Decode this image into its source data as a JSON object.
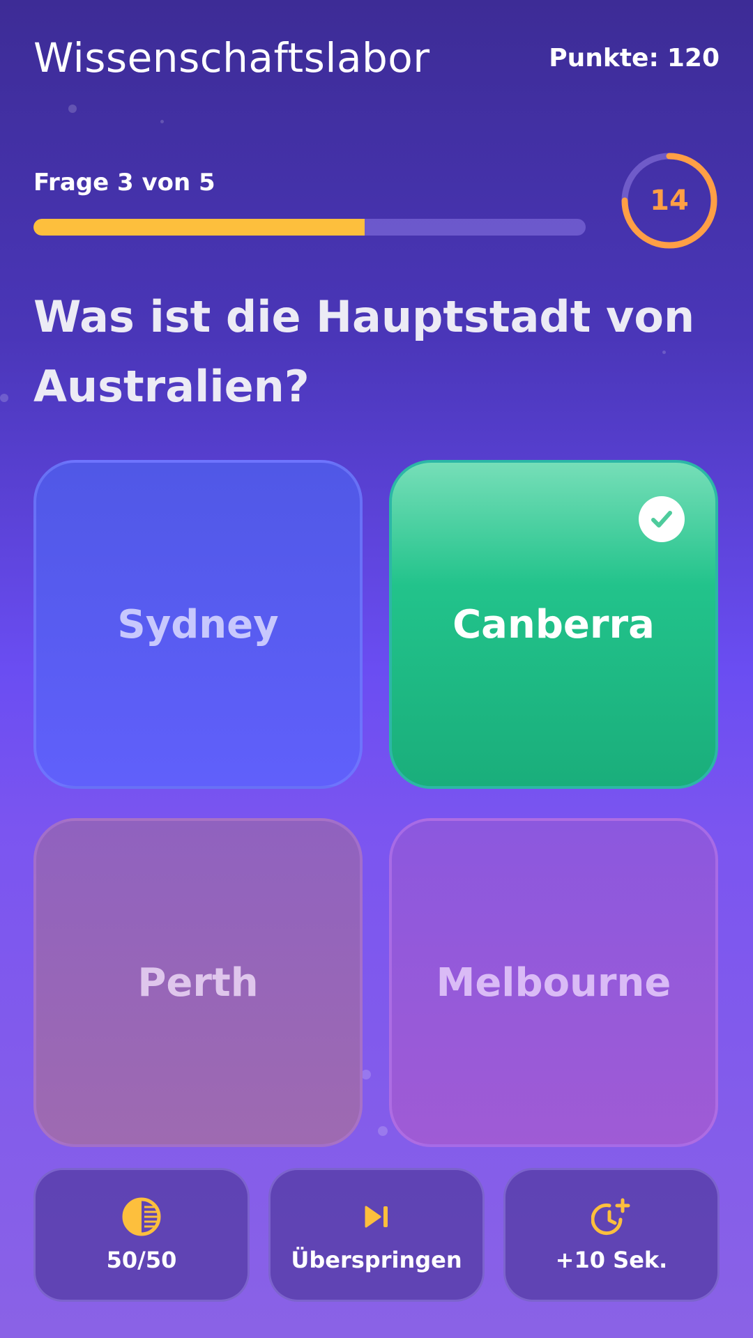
{
  "header": {
    "title": "Wissenschaftslabor",
    "score_label": "Punkte:",
    "score_value": "120"
  },
  "progress": {
    "counter_text": "Frage 3 von 5",
    "fraction_complete": 0.6
  },
  "timer": {
    "seconds_left": "14",
    "fraction_remaining": 0.75
  },
  "question": {
    "text": "Was ist die Hauptstadt von Australien?"
  },
  "answers": [
    {
      "label": "Sydney",
      "state": "default"
    },
    {
      "label": "Canberra",
      "state": "correct"
    },
    {
      "label": "Perth",
      "state": "default"
    },
    {
      "label": "Melbourne",
      "state": "default"
    }
  ],
  "lifelines": [
    {
      "label": "50/50",
      "icon": "half-circle-icon"
    },
    {
      "label": "Überspringen",
      "icon": "skip-next-icon"
    },
    {
      "label": "+10 Sek.",
      "icon": "clock-plus-icon"
    }
  ],
  "colors": {
    "accent_yellow": "#fdbf3d",
    "timer_orange": "#ff9f45",
    "correct_green": "#22c38b",
    "check_green": "#4ecb9c"
  }
}
